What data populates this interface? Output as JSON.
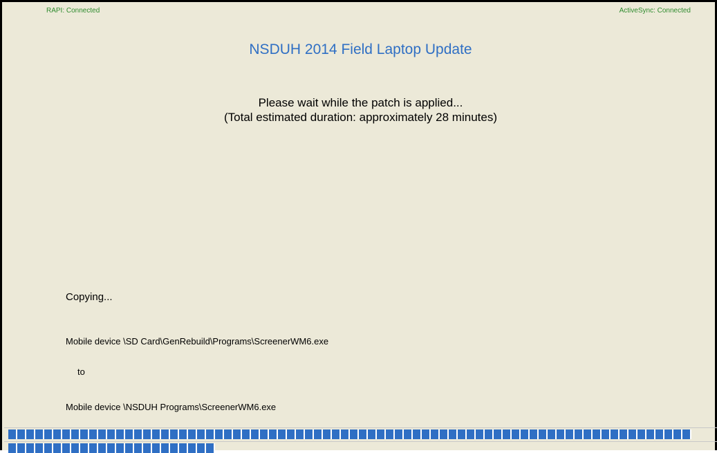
{
  "status": {
    "rapi": "RAPI: Connected",
    "activesync": "ActiveSync: Connected",
    "color": "#2e8b2e"
  },
  "header": {
    "title": "NSDUH 2014 Field Laptop Update",
    "title_color": "#2f6fc4"
  },
  "message": {
    "line1": "Please wait while the patch is applied...",
    "line2": "(Total estimated duration: approximately 28 minutes)"
  },
  "copy": {
    "status": "Copying...",
    "source": "Mobile device \\SD Card\\GenRebuild\\Programs\\ScreenerWM6.exe",
    "to_label": "to",
    "destination": "Mobile device \\NSDUH Programs\\ScreenerWM6.exe"
  },
  "progress": {
    "file_fraction": 0.96,
    "overall_fraction": 0.29,
    "color": "#2f6fc4"
  }
}
